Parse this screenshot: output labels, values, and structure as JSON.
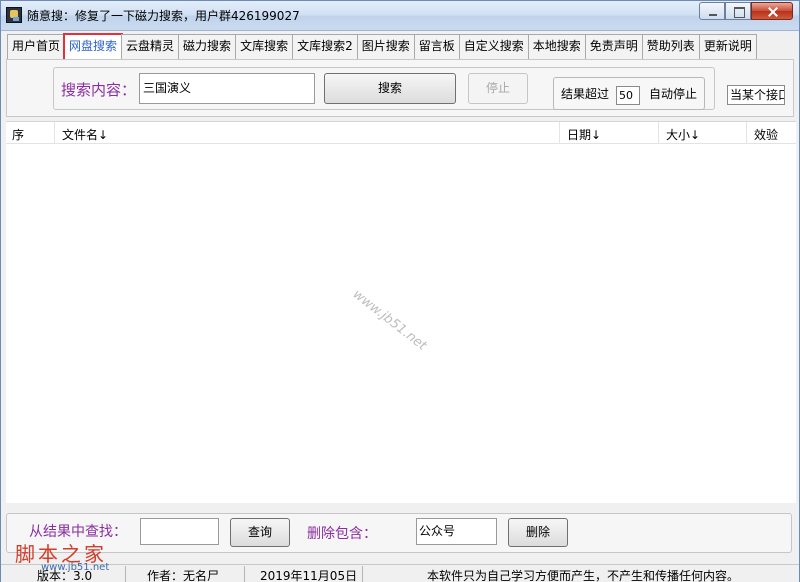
{
  "window": {
    "title": "随意搜：修复了一下磁力搜索，用户群426199027"
  },
  "tabs": [
    {
      "label": "用户首页"
    },
    {
      "label": "网盘搜索"
    },
    {
      "label": "云盘精灵"
    },
    {
      "label": "磁力搜索"
    },
    {
      "label": "文库搜索"
    },
    {
      "label": "文库搜索2"
    },
    {
      "label": "图片搜索"
    },
    {
      "label": "留言板"
    },
    {
      "label": "自定义搜索"
    },
    {
      "label": "本地搜索"
    },
    {
      "label": "免责声明"
    },
    {
      "label": "赞助列表"
    },
    {
      "label": "更新说明"
    }
  ],
  "active_tab": "网盘搜索",
  "search": {
    "label": "搜索内容：",
    "value": "三国演义",
    "search_button": "搜索",
    "stop_button": "停止",
    "limit_label": "结果超过",
    "limit_value": "50",
    "auto_stop_label": "自动停止",
    "truncated_option": "当某个接口"
  },
  "list": {
    "columns": [
      "序",
      "文件名↓",
      "日期↓",
      "大小↓",
      "效验"
    ]
  },
  "watermark": "www.jb51.net",
  "filter": {
    "find_label": "从结果中查找：",
    "find_value": "",
    "query_button": "查询",
    "delete_label": "删除包含：",
    "delete_value": "公众号",
    "delete_button": "删除"
  },
  "brand": {
    "name": "脚本之家",
    "url": "www.jb51.net"
  },
  "statusbar": {
    "version": "版本：3.0",
    "author": "作者：无名尸",
    "date": "2019年11月05日",
    "notice": "本软件只为自己学习方便而产生，不产生和传播任何内容。"
  },
  "colors": {
    "label_purple": "#8b2ea0",
    "active_tab_text": "#2d64c6",
    "highlight_red": "#e0313d",
    "brand_red": "#d33c2a"
  }
}
